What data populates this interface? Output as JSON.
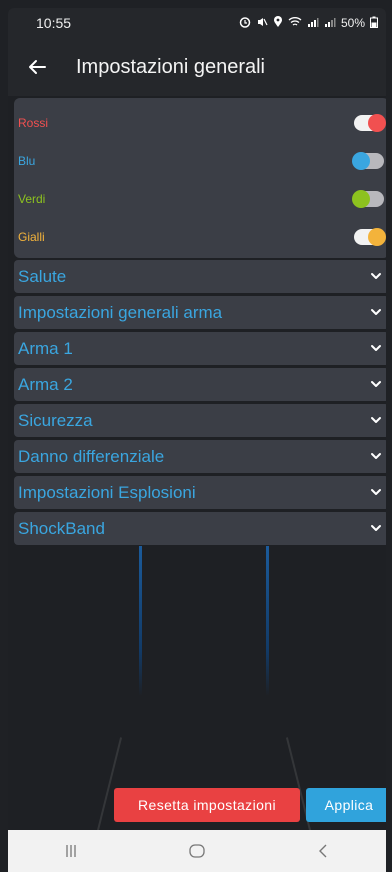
{
  "status_bar": {
    "time": "10:55",
    "battery": "50%"
  },
  "app_bar": {
    "title": "Impostazioni generali"
  },
  "teams": [
    {
      "label": "Rossi",
      "color": "#f15050",
      "enabled": true
    },
    {
      "label": "Blu",
      "color": "#3aa6e0",
      "enabled": false
    },
    {
      "label": "Verdi",
      "color": "#8dc21f",
      "enabled": false
    },
    {
      "label": "Gialli",
      "color": "#f3b33b",
      "enabled": true
    }
  ],
  "sections": [
    {
      "label": "Salute"
    },
    {
      "label": "Impostazioni generali arma"
    },
    {
      "label": "Arma 1"
    },
    {
      "label": "Arma 2"
    },
    {
      "label": "Sicurezza"
    },
    {
      "label": "Danno differenziale"
    },
    {
      "label": "Impostazioni Esplosioni"
    },
    {
      "label": "ShockBand"
    }
  ],
  "buttons": {
    "reset_label": "Resetta impostazioni",
    "apply_label": "Applica"
  },
  "icons": {
    "back": "arrow-left-icon",
    "chevron": "chevron-down-icon",
    "nav": [
      "recent-apps-icon",
      "home-icon",
      "back-nav-icon"
    ]
  },
  "colors": {
    "accent": "#3aa6e0",
    "danger": "#e94142",
    "card": "#3b3e46",
    "background": "#1e2024"
  }
}
